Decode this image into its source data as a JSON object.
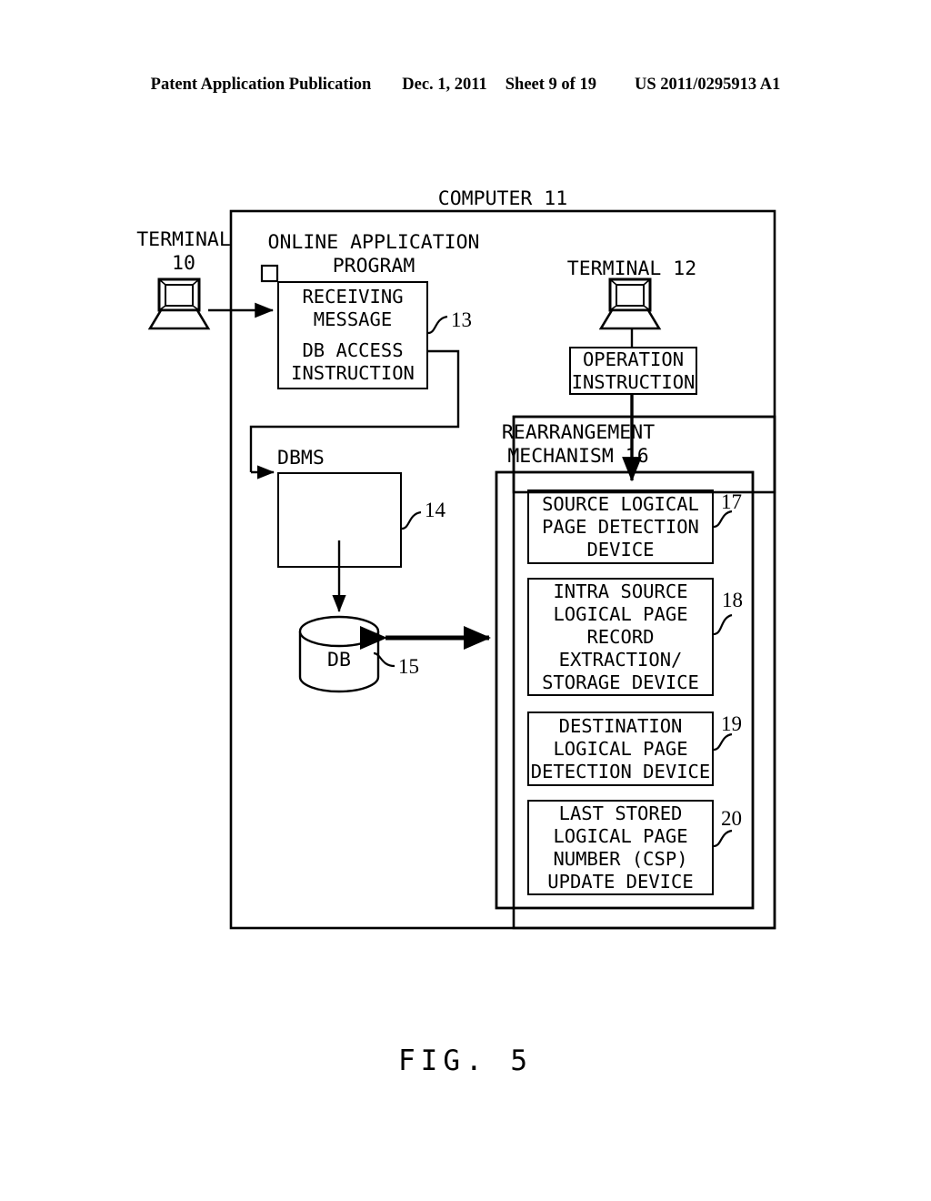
{
  "header": {
    "publication": "Patent Application Publication",
    "date": "Dec. 1, 2011",
    "sheet": "Sheet 9 of 19",
    "docnum": "US 2011/0295913 A1"
  },
  "figure": {
    "caption": "FIG. 5"
  },
  "diagram": {
    "computer": {
      "label": "COMPUTER 11"
    },
    "terminal_10": {
      "label_line1": "TERMINAL",
      "label_line2": "10",
      "icon": "terminal-icon"
    },
    "terminal_12": {
      "label": "TERMINAL 12",
      "icon": "terminal-icon"
    },
    "online_application_program": {
      "label_line1": "ONLINE APPLICATION",
      "label_line2": "PROGRAM"
    },
    "receiving_message_box": {
      "line1": "RECEIVING",
      "line2": "MESSAGE",
      "line3": "DB ACCESS",
      "line4": "INSTRUCTION",
      "ref": "13"
    },
    "operation_instruction_box": {
      "line1": "OPERATION",
      "line2": "INSTRUCTION"
    },
    "dbms": {
      "label": "DBMS",
      "ref": "14"
    },
    "db": {
      "label": "DB",
      "ref": "15"
    },
    "rearrangement_mechanism": {
      "label_line1": "REARRANGEMENT",
      "label_line2": "MECHANISM 16"
    },
    "devices": [
      {
        "ref": "17",
        "lines": [
          "SOURCE LOGICAL",
          "PAGE DETECTION",
          "DEVICE"
        ]
      },
      {
        "ref": "18",
        "lines": [
          "INTRA SOURCE",
          "LOGICAL PAGE",
          "RECORD",
          "EXTRACTION/",
          "STORAGE DEVICE"
        ]
      },
      {
        "ref": "19",
        "lines": [
          "DESTINATION",
          "LOGICAL PAGE",
          "DETECTION DEVICE"
        ]
      },
      {
        "ref": "20",
        "lines": [
          "LAST STORED",
          "LOGICAL PAGE",
          "NUMBER (CSP)",
          "UPDATE DEVICE"
        ]
      }
    ]
  },
  "colors": {
    "ink": "#000000",
    "paper": "#ffffff"
  }
}
